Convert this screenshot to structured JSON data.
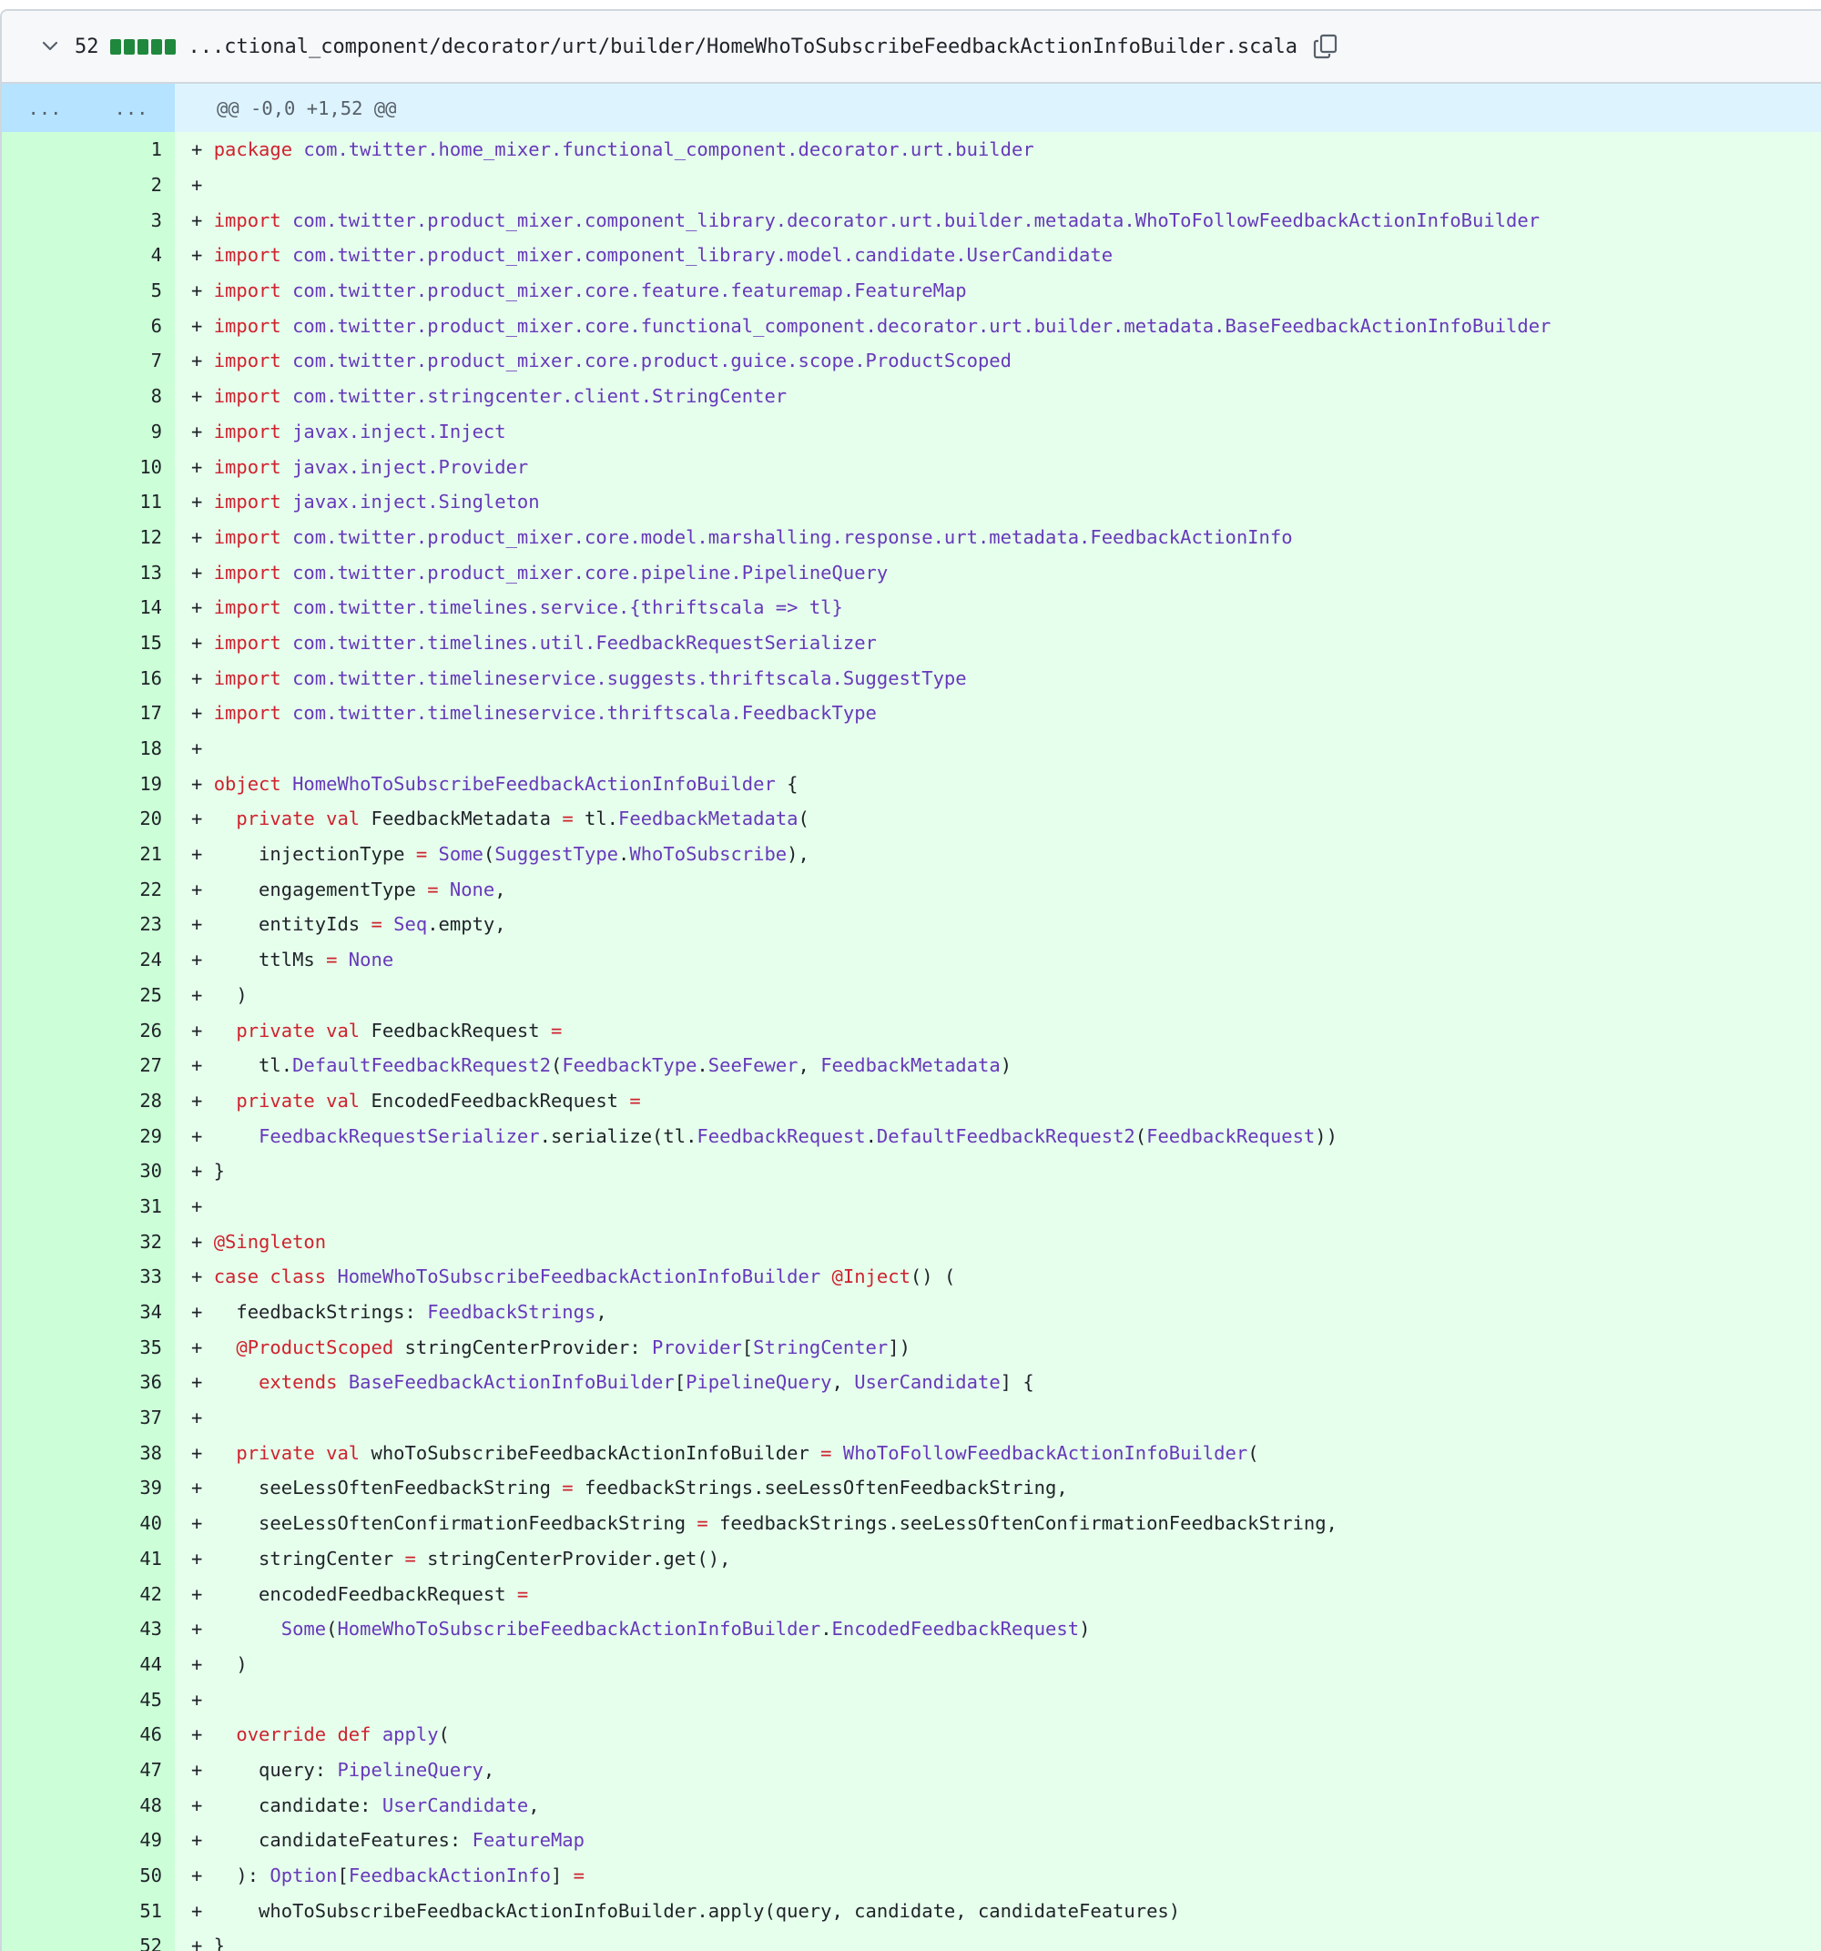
{
  "header": {
    "expand_icon": "chevron-down-icon",
    "line_count": "52",
    "diffstat_color": "#1f883d",
    "filename": "...ctional_component/decorator/urt/builder/HomeWhoToSubscribeFeedbackActionInfoBuilder.scala",
    "copy_icon": "copy-icon"
  },
  "hunk": {
    "expand_left": "...",
    "expand_right": "...",
    "header": "@@ -0,0 +1,52 @@"
  },
  "colors": {
    "keyword": "#cf222e",
    "type": "#6639ba",
    "added_background": "#e6ffec",
    "added_gutter": "#ccffd8"
  },
  "lines": [
    {
      "n": "1",
      "tokens": [
        [
          "+ ",
          ""
        ],
        [
          "package",
          "k"
        ],
        [
          " com.twitter.home_mixer.functional_component.decorator.urt.builder",
          "t"
        ]
      ]
    },
    {
      "n": "2",
      "tokens": [
        [
          "+",
          ""
        ]
      ]
    },
    {
      "n": "3",
      "tokens": [
        [
          "+ ",
          ""
        ],
        [
          "import",
          "k"
        ],
        [
          " com.twitter.product_mixer.component_library.decorator.urt.builder.metadata.WhoToFollowFeedbackActionInfoBuilder",
          "t"
        ]
      ]
    },
    {
      "n": "4",
      "tokens": [
        [
          "+ ",
          ""
        ],
        [
          "import",
          "k"
        ],
        [
          " com.twitter.product_mixer.component_library.model.candidate.UserCandidate",
          "t"
        ]
      ]
    },
    {
      "n": "5",
      "tokens": [
        [
          "+ ",
          ""
        ],
        [
          "import",
          "k"
        ],
        [
          " com.twitter.product_mixer.core.feature.featuremap.FeatureMap",
          "t"
        ]
      ]
    },
    {
      "n": "6",
      "tokens": [
        [
          "+ ",
          ""
        ],
        [
          "import",
          "k"
        ],
        [
          " com.twitter.product_mixer.core.functional_component.decorator.urt.builder.metadata.BaseFeedbackActionInfoBuilder",
          "t"
        ]
      ]
    },
    {
      "n": "7",
      "tokens": [
        [
          "+ ",
          ""
        ],
        [
          "import",
          "k"
        ],
        [
          " com.twitter.product_mixer.core.product.guice.scope.ProductScoped",
          "t"
        ]
      ]
    },
    {
      "n": "8",
      "tokens": [
        [
          "+ ",
          ""
        ],
        [
          "import",
          "k"
        ],
        [
          " com.twitter.stringcenter.client.StringCenter",
          "t"
        ]
      ]
    },
    {
      "n": "9",
      "tokens": [
        [
          "+ ",
          ""
        ],
        [
          "import",
          "k"
        ],
        [
          " javax.inject.Inject",
          "t"
        ]
      ]
    },
    {
      "n": "10",
      "tokens": [
        [
          "+ ",
          ""
        ],
        [
          "import",
          "k"
        ],
        [
          " javax.inject.Provider",
          "t"
        ]
      ]
    },
    {
      "n": "11",
      "tokens": [
        [
          "+ ",
          ""
        ],
        [
          "import",
          "k"
        ],
        [
          " javax.inject.Singleton",
          "t"
        ]
      ]
    },
    {
      "n": "12",
      "tokens": [
        [
          "+ ",
          ""
        ],
        [
          "import",
          "k"
        ],
        [
          " com.twitter.product_mixer.core.model.marshalling.response.urt.metadata.FeedbackActionInfo",
          "t"
        ]
      ]
    },
    {
      "n": "13",
      "tokens": [
        [
          "+ ",
          ""
        ],
        [
          "import",
          "k"
        ],
        [
          " com.twitter.product_mixer.core.pipeline.PipelineQuery",
          "t"
        ]
      ]
    },
    {
      "n": "14",
      "tokens": [
        [
          "+ ",
          ""
        ],
        [
          "import",
          "k"
        ],
        [
          " com.twitter.timelines.service.{thriftscala => tl}",
          "t"
        ]
      ]
    },
    {
      "n": "15",
      "tokens": [
        [
          "+ ",
          ""
        ],
        [
          "import",
          "k"
        ],
        [
          " com.twitter.timelines.util.FeedbackRequestSerializer",
          "t"
        ]
      ]
    },
    {
      "n": "16",
      "tokens": [
        [
          "+ ",
          ""
        ],
        [
          "import",
          "k"
        ],
        [
          " com.twitter.timelineservice.suggests.thriftscala.SuggestType",
          "t"
        ]
      ]
    },
    {
      "n": "17",
      "tokens": [
        [
          "+ ",
          ""
        ],
        [
          "import",
          "k"
        ],
        [
          " com.twitter.timelineservice.thriftscala.FeedbackType",
          "t"
        ]
      ]
    },
    {
      "n": "18",
      "tokens": [
        [
          "+",
          ""
        ]
      ]
    },
    {
      "n": "19",
      "tokens": [
        [
          "+ ",
          ""
        ],
        [
          "object",
          "k"
        ],
        [
          " ",
          ""
        ],
        [
          "HomeWhoToSubscribeFeedbackActionInfoBuilder",
          "t"
        ],
        [
          " {",
          ""
        ]
      ]
    },
    {
      "n": "20",
      "tokens": [
        [
          "+   ",
          ""
        ],
        [
          "private val",
          "k"
        ],
        [
          " FeedbackMetadata ",
          ""
        ],
        [
          "=",
          "k"
        ],
        [
          " tl.",
          ""
        ],
        [
          "FeedbackMetadata",
          "t"
        ],
        [
          "(",
          ""
        ]
      ]
    },
    {
      "n": "21",
      "tokens": [
        [
          "+     injectionType ",
          ""
        ],
        [
          "=",
          "k"
        ],
        [
          " ",
          ""
        ],
        [
          "Some",
          "t"
        ],
        [
          "(",
          ""
        ],
        [
          "SuggestType",
          "t"
        ],
        [
          ".",
          ""
        ],
        [
          "WhoToSubscribe",
          "t"
        ],
        [
          "),",
          ""
        ]
      ]
    },
    {
      "n": "22",
      "tokens": [
        [
          "+     engagementType ",
          ""
        ],
        [
          "=",
          "k"
        ],
        [
          " ",
          ""
        ],
        [
          "None",
          "t"
        ],
        [
          ",",
          ""
        ]
      ]
    },
    {
      "n": "23",
      "tokens": [
        [
          "+     entityIds ",
          ""
        ],
        [
          "=",
          "k"
        ],
        [
          " ",
          ""
        ],
        [
          "Seq",
          "t"
        ],
        [
          ".empty,",
          ""
        ]
      ]
    },
    {
      "n": "24",
      "tokens": [
        [
          "+     ttlMs ",
          ""
        ],
        [
          "=",
          "k"
        ],
        [
          " ",
          ""
        ],
        [
          "None",
          "t"
        ]
      ]
    },
    {
      "n": "25",
      "tokens": [
        [
          "+   )",
          ""
        ]
      ]
    },
    {
      "n": "26",
      "tokens": [
        [
          "+   ",
          ""
        ],
        [
          "private val",
          "k"
        ],
        [
          " FeedbackRequest ",
          ""
        ],
        [
          "=",
          "k"
        ]
      ]
    },
    {
      "n": "27",
      "tokens": [
        [
          "+     tl.",
          ""
        ],
        [
          "DefaultFeedbackRequest2",
          "t"
        ],
        [
          "(",
          ""
        ],
        [
          "FeedbackType",
          "t"
        ],
        [
          ".",
          ""
        ],
        [
          "SeeFewer",
          "t"
        ],
        [
          ", ",
          ""
        ],
        [
          "FeedbackMetadata",
          "t"
        ],
        [
          ")",
          ""
        ]
      ]
    },
    {
      "n": "28",
      "tokens": [
        [
          "+   ",
          ""
        ],
        [
          "private val",
          "k"
        ],
        [
          " EncodedFeedbackRequest ",
          ""
        ],
        [
          "=",
          "k"
        ]
      ]
    },
    {
      "n": "29",
      "tokens": [
        [
          "+     ",
          ""
        ],
        [
          "FeedbackRequestSerializer",
          "t"
        ],
        [
          ".serialize(tl.",
          ""
        ],
        [
          "FeedbackRequest",
          "t"
        ],
        [
          ".",
          ""
        ],
        [
          "DefaultFeedbackRequest2",
          "t"
        ],
        [
          "(",
          ""
        ],
        [
          "FeedbackRequest",
          "t"
        ],
        [
          "))",
          ""
        ]
      ]
    },
    {
      "n": "30",
      "tokens": [
        [
          "+ }",
          ""
        ]
      ]
    },
    {
      "n": "31",
      "tokens": [
        [
          "+",
          ""
        ]
      ]
    },
    {
      "n": "32",
      "tokens": [
        [
          "+ ",
          ""
        ],
        [
          "@Singleton",
          "k"
        ]
      ]
    },
    {
      "n": "33",
      "tokens": [
        [
          "+ ",
          ""
        ],
        [
          "case class",
          "k"
        ],
        [
          " ",
          ""
        ],
        [
          "HomeWhoToSubscribeFeedbackActionInfoBuilder",
          "t"
        ],
        [
          " ",
          ""
        ],
        [
          "@Inject",
          "k"
        ],
        [
          "() (",
          ""
        ]
      ]
    },
    {
      "n": "34",
      "tokens": [
        [
          "+   feedbackStrings: ",
          ""
        ],
        [
          "FeedbackStrings",
          "t"
        ],
        [
          ",",
          ""
        ]
      ]
    },
    {
      "n": "35",
      "tokens": [
        [
          "+   ",
          ""
        ],
        [
          "@ProductScoped",
          "k"
        ],
        [
          " stringCenterProvider: ",
          ""
        ],
        [
          "Provider",
          "t"
        ],
        [
          "[",
          ""
        ],
        [
          "StringCenter",
          "t"
        ],
        [
          "])",
          ""
        ]
      ]
    },
    {
      "n": "36",
      "tokens": [
        [
          "+     ",
          ""
        ],
        [
          "extends",
          "k"
        ],
        [
          " ",
          ""
        ],
        [
          "BaseFeedbackActionInfoBuilder",
          "t"
        ],
        [
          "[",
          ""
        ],
        [
          "PipelineQuery",
          "t"
        ],
        [
          ", ",
          ""
        ],
        [
          "UserCandidate",
          "t"
        ],
        [
          "] {",
          ""
        ]
      ]
    },
    {
      "n": "37",
      "tokens": [
        [
          "+",
          ""
        ]
      ]
    },
    {
      "n": "38",
      "tokens": [
        [
          "+   ",
          ""
        ],
        [
          "private val",
          "k"
        ],
        [
          " whoToSubscribeFeedbackActionInfoBuilder ",
          ""
        ],
        [
          "=",
          "k"
        ],
        [
          " ",
          ""
        ],
        [
          "WhoToFollowFeedbackActionInfoBuilder",
          "t"
        ],
        [
          "(",
          ""
        ]
      ]
    },
    {
      "n": "39",
      "tokens": [
        [
          "+     seeLessOftenFeedbackString ",
          ""
        ],
        [
          "=",
          "k"
        ],
        [
          " feedbackStrings.seeLessOftenFeedbackString,",
          ""
        ]
      ]
    },
    {
      "n": "40",
      "tokens": [
        [
          "+     seeLessOftenConfirmationFeedbackString ",
          ""
        ],
        [
          "=",
          "k"
        ],
        [
          " feedbackStrings.seeLessOftenConfirmationFeedbackString,",
          ""
        ]
      ]
    },
    {
      "n": "41",
      "tokens": [
        [
          "+     stringCenter ",
          ""
        ],
        [
          "=",
          "k"
        ],
        [
          " stringCenterProvider.get(),",
          ""
        ]
      ]
    },
    {
      "n": "42",
      "tokens": [
        [
          "+     encodedFeedbackRequest ",
          ""
        ],
        [
          "=",
          "k"
        ]
      ]
    },
    {
      "n": "43",
      "tokens": [
        [
          "+       ",
          ""
        ],
        [
          "Some",
          "t"
        ],
        [
          "(",
          ""
        ],
        [
          "HomeWhoToSubscribeFeedbackActionInfoBuilder",
          "t"
        ],
        [
          ".",
          ""
        ],
        [
          "EncodedFeedbackRequest",
          "t"
        ],
        [
          ")",
          ""
        ]
      ]
    },
    {
      "n": "44",
      "tokens": [
        [
          "+   )",
          ""
        ]
      ]
    },
    {
      "n": "45",
      "tokens": [
        [
          "+",
          ""
        ]
      ]
    },
    {
      "n": "46",
      "tokens": [
        [
          "+   ",
          ""
        ],
        [
          "override def",
          "k"
        ],
        [
          " ",
          ""
        ],
        [
          "apply",
          "t"
        ],
        [
          "(",
          ""
        ]
      ]
    },
    {
      "n": "47",
      "tokens": [
        [
          "+     query: ",
          ""
        ],
        [
          "PipelineQuery",
          "t"
        ],
        [
          ",",
          ""
        ]
      ]
    },
    {
      "n": "48",
      "tokens": [
        [
          "+     candidate: ",
          ""
        ],
        [
          "UserCandidate",
          "t"
        ],
        [
          ",",
          ""
        ]
      ]
    },
    {
      "n": "49",
      "tokens": [
        [
          "+     candidateFeatures: ",
          ""
        ],
        [
          "FeatureMap",
          "t"
        ]
      ]
    },
    {
      "n": "50",
      "tokens": [
        [
          "+   ): ",
          ""
        ],
        [
          "Option",
          "t"
        ],
        [
          "[",
          ""
        ],
        [
          "FeedbackActionInfo",
          "t"
        ],
        [
          "] ",
          ""
        ],
        [
          "=",
          "k"
        ]
      ]
    },
    {
      "n": "51",
      "tokens": [
        [
          "+     whoToSubscribeFeedbackActionInfoBuilder.apply(query, candidate, candidateFeatures)",
          ""
        ]
      ]
    },
    {
      "n": "52",
      "tokens": [
        [
          "+ }",
          ""
        ]
      ]
    }
  ]
}
